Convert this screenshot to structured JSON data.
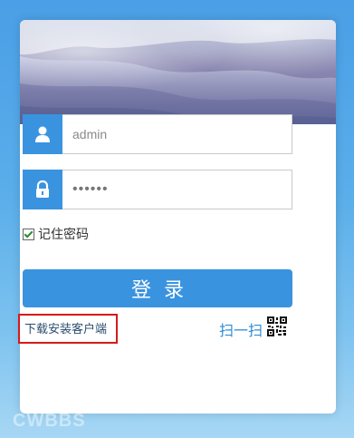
{
  "login": {
    "username_value": "admin",
    "password_value": "••••••",
    "remember_label": "记住密码",
    "submit_label": "登录",
    "download_link": "下载安装客户端",
    "scan_label": "扫一扫"
  },
  "watermark": "CWBBS",
  "colors": {
    "accent": "#3a93df",
    "highlight_border": "#d61a1a"
  }
}
